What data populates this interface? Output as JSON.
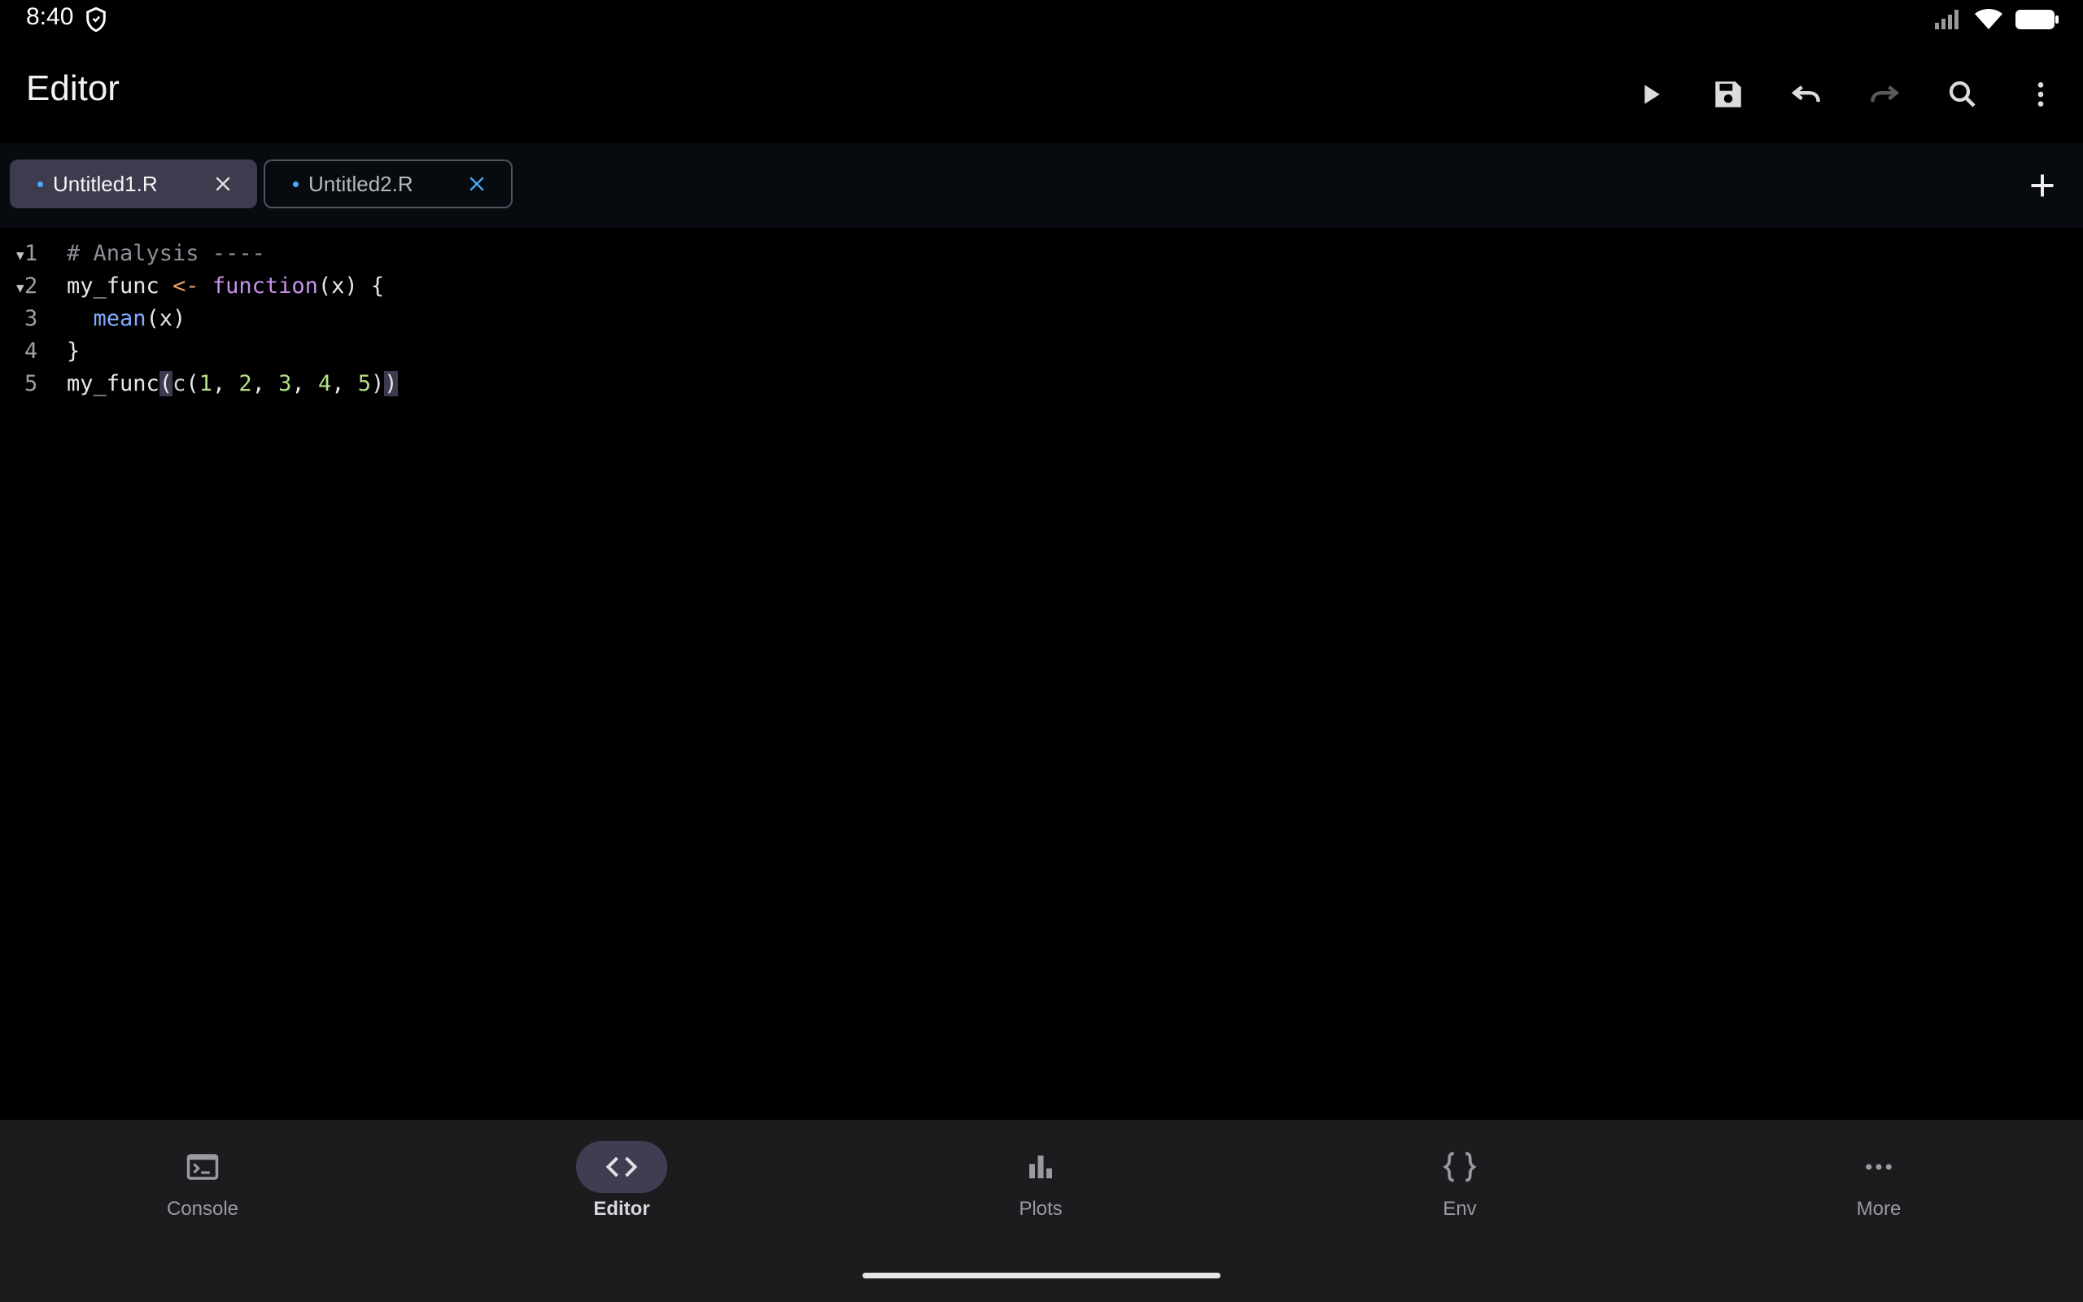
{
  "status": {
    "time": "8:40"
  },
  "app_bar": {
    "title": "Editor",
    "actions": [
      "run",
      "save",
      "undo",
      "redo",
      "search",
      "more"
    ]
  },
  "tabs": [
    {
      "label": "Untitled1.R",
      "modified": true,
      "active": true
    },
    {
      "label": "Untitled2.R",
      "modified": true,
      "active": false
    }
  ],
  "editor": {
    "line_numbers": [
      "1",
      "2",
      "3",
      "4",
      "5"
    ],
    "lines": [
      "# Analysis ----",
      "my_func <- function(x) {",
      "  mean(x)",
      "}",
      "my_func(c(1, 2, 3, 4, 5))"
    ],
    "tokens": {
      "l1_comment": "# Analysis ----",
      "l2_name": "my_func ",
      "l2_op": "<-",
      "l2_kw": "function",
      "l2_rest": "(x) {",
      "l3_indent": "  ",
      "l3_fn": "mean",
      "l3_rest": "(x)",
      "l4": "}",
      "l5_name": "my_func",
      "l5_open": "(",
      "l5_c": "c",
      "l5_p1": "(",
      "l5_n1": "1",
      "l5_s1": ", ",
      "l5_n2": "2",
      "l5_s2": ", ",
      "l5_n3": "3",
      "l5_s3": ", ",
      "l5_n4": "4",
      "l5_s4": ", ",
      "l5_n5": "5",
      "l5_p2": ")",
      "l5_close": ")"
    }
  },
  "bottom_nav": [
    {
      "label": "Console",
      "icon": "terminal-icon",
      "active": false
    },
    {
      "label": "Editor",
      "icon": "code-icon",
      "active": true
    },
    {
      "label": "Plots",
      "icon": "bar-chart-icon",
      "active": false
    },
    {
      "label": "Env",
      "icon": "braces-icon",
      "active": false
    },
    {
      "label": "More",
      "icon": "more-horiz-icon",
      "active": false
    }
  ],
  "colors": {
    "accent": "#4aa8ff",
    "active_tab": "#3d3b4d",
    "nav_pill": "#3f3d52",
    "nav_background": "#1c1c1f"
  }
}
